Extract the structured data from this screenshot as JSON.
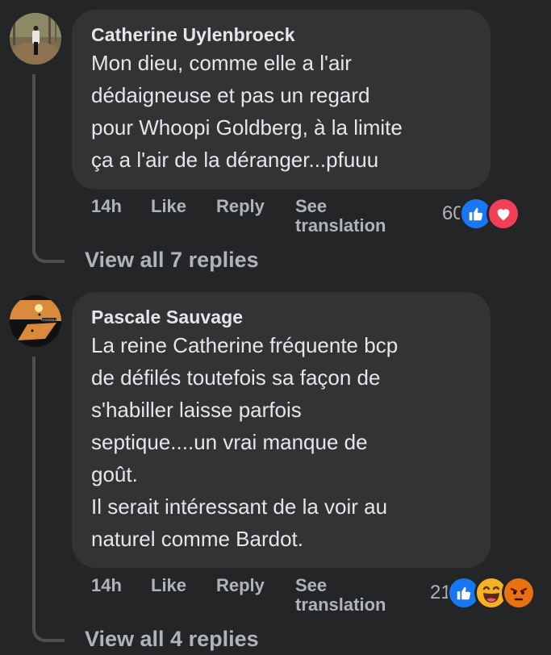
{
  "comments": [
    {
      "author": "Catherine Uylenbroeck",
      "avatar": "avatar-woman-in-forest",
      "text": "Mon dieu, comme elle a l'air\ndédaigneuse et pas un regard\npour Whoopi Goldberg, à la limite\nça a l'air de la déranger...pfuuu",
      "time": "14h",
      "like_label": "Like",
      "reply_label": "Reply",
      "translate_label": "See\ntranslation",
      "reaction_count": "60",
      "reactions": [
        "like",
        "love"
      ],
      "view_replies": "View all 7 replies"
    },
    {
      "author": "Pascale Sauvage",
      "avatar": "avatar-sunset-silhouette",
      "text": "La reine Catherine fréquente bcp\nde défilés toutefois sa façon de\ns'habiller laisse parfois\nseptique....un vrai manque de\ngoût.\nIl serait intéressant de la voir au\nnaturel comme Bardot.",
      "time": "14h",
      "like_label": "Like",
      "reply_label": "Reply",
      "translate_label": "See\ntranslation",
      "reaction_count": "21",
      "reactions": [
        "like",
        "haha",
        "angry"
      ],
      "view_replies": "View all 4 replies"
    }
  ],
  "colors": {
    "background": "#242526",
    "bubble": "#333334",
    "primary_text": "#e4e6eb",
    "secondary_text": "#b0b3b8",
    "like_blue": "#1877f2",
    "love_red": "#f33e58",
    "haha_yellow": "#f7b125",
    "angry_orange": "#e9710f"
  }
}
